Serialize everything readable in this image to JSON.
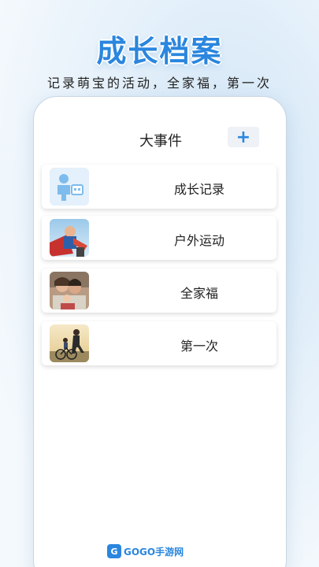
{
  "promo": {
    "headline": "成长档案",
    "subline": "记录萌宝的活动，全家福，第一次"
  },
  "screen": {
    "title": "大事件",
    "add_button": "+",
    "cards": [
      {
        "label": "成长记录",
        "thumb_icon": "baby-icon"
      },
      {
        "label": "户外运动",
        "thumb_icon": "outdoor-photo"
      },
      {
        "label": "全家福",
        "thumb_icon": "family-photo"
      },
      {
        "label": "第一次",
        "thumb_icon": "first-time-photo"
      }
    ]
  },
  "footer": {
    "logo_mark": "G",
    "logo_text": "GOGO手游网"
  },
  "colors": {
    "accent": "#2a86de",
    "card_bg": "#ffffff",
    "page_bg": "#e6f1fa"
  }
}
